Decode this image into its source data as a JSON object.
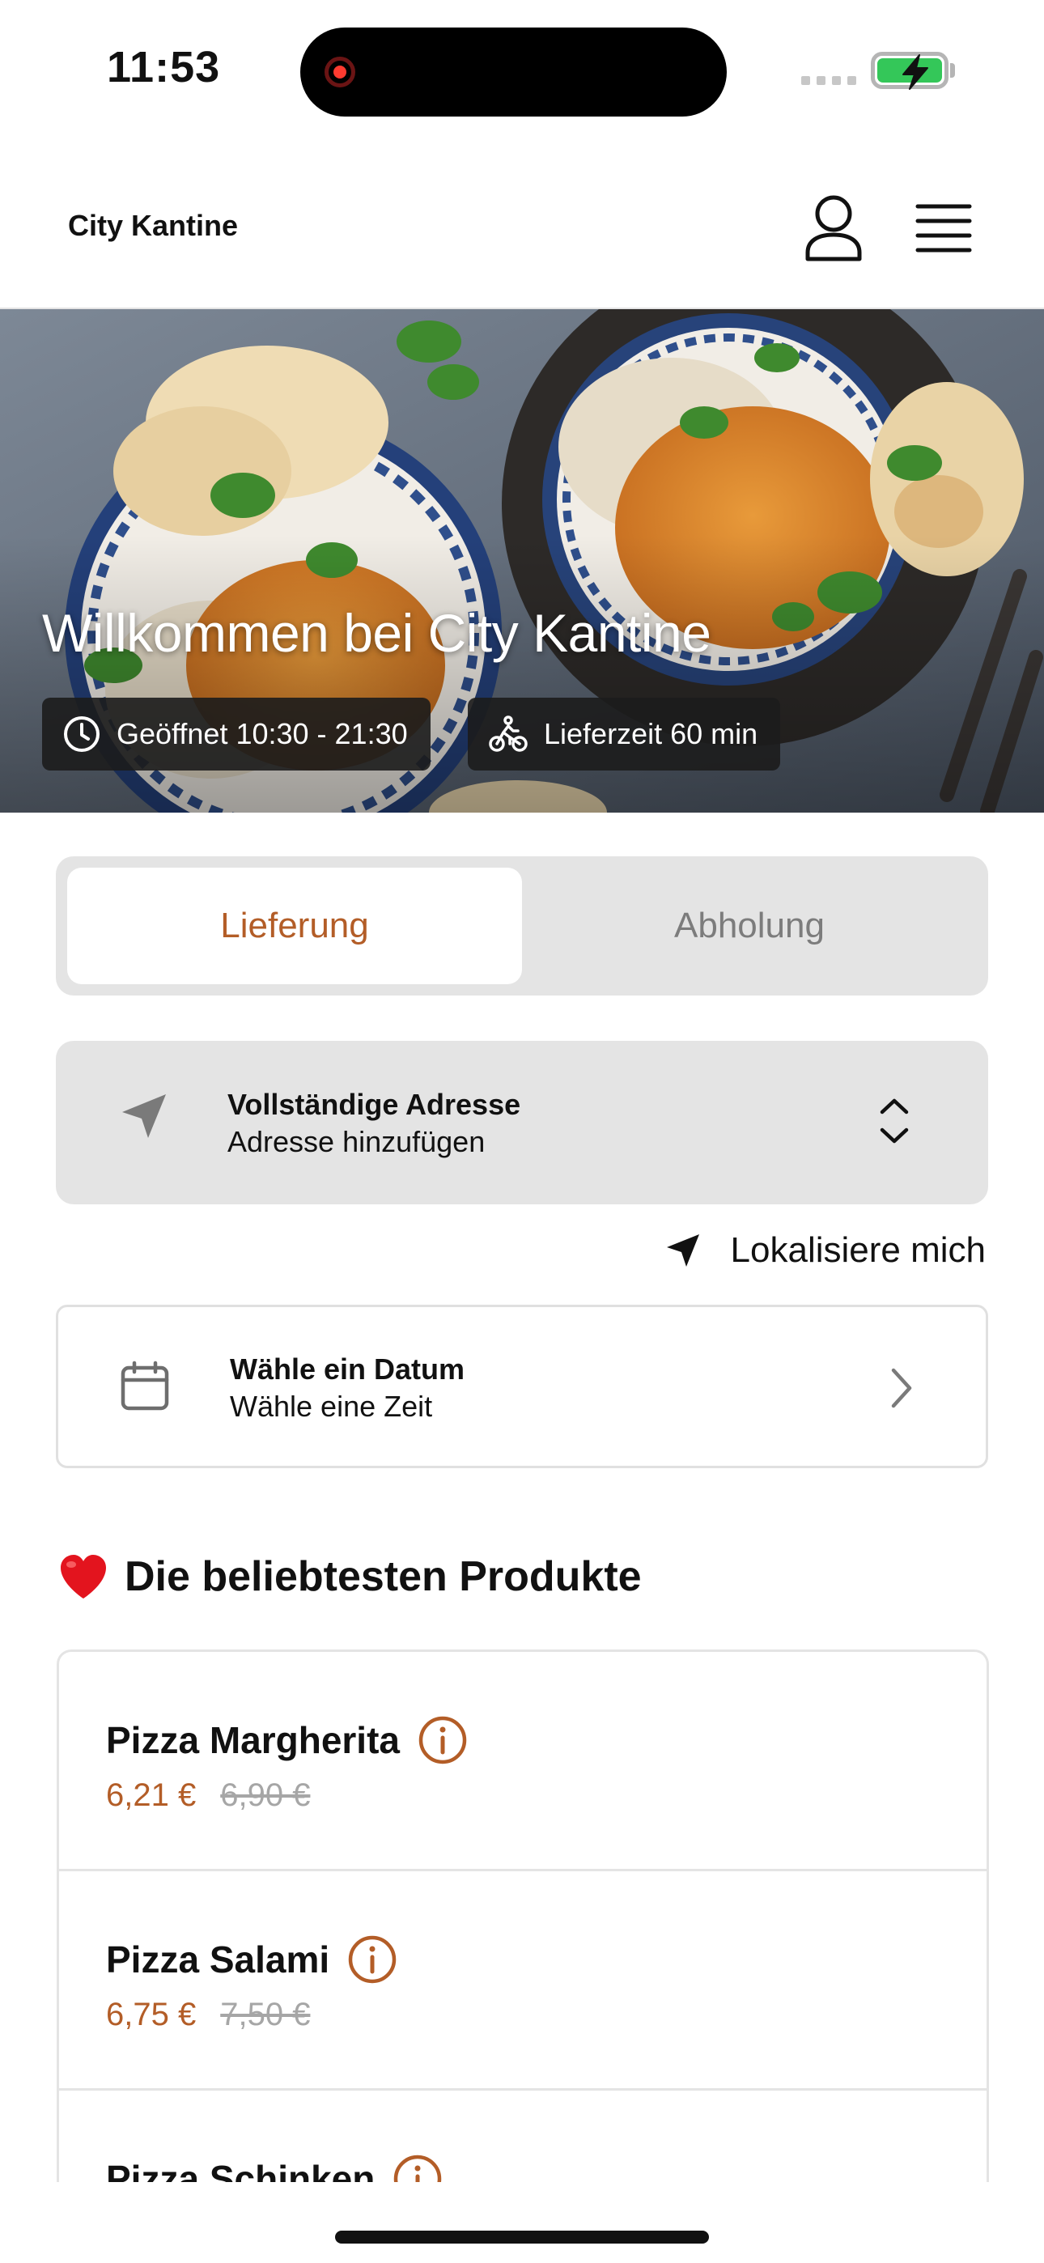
{
  "status_bar": {
    "time": "11:53"
  },
  "header": {
    "brand": "City Kantine",
    "icons": [
      "user-icon",
      "hamburger-menu-icon"
    ]
  },
  "hero": {
    "title": "Willkommen bei City Kantine",
    "opening_hours": "Geöffnet 10:30 - 21:30",
    "delivery_time": "Lieferzeit 60 min"
  },
  "order_mode": {
    "options": [
      "Lieferung",
      "Abholung"
    ],
    "selected": "Lieferung"
  },
  "address": {
    "title": "Vollständige Adresse",
    "subtitle": "Adresse hinzufügen"
  },
  "locate": {
    "label": "Lokalisiere mich"
  },
  "schedule": {
    "title": "Wähle ein Datum",
    "subtitle": "Wähle eine Zeit"
  },
  "popular": {
    "emoji": "❤️",
    "title": "Die beliebtesten Produkte",
    "products": [
      {
        "name": "Pizza Margherita",
        "price": "6,21 €",
        "old_price": "6,90 €"
      },
      {
        "name": "Pizza Salami",
        "price": "6,75 €",
        "old_price": "7,50 €"
      },
      {
        "name": "Pizza Schinken",
        "price": "",
        "old_price": ""
      }
    ]
  },
  "colors": {
    "accent": "#b35d27",
    "segment_bg": "#e4e4e4",
    "battery": "#34c759"
  }
}
